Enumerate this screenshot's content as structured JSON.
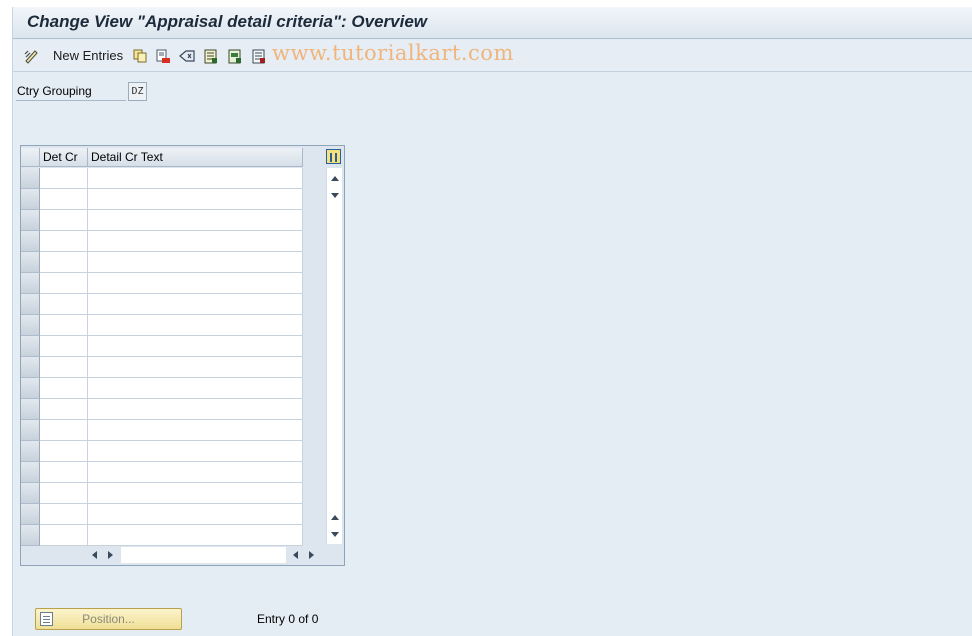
{
  "window": {
    "title": "Change View \"Appraisal detail criteria\": Overview"
  },
  "toolbar": {
    "new_entries_label": "New Entries",
    "watermark": "www.tutorialkart.com",
    "icons": [
      "edit-pencil-icon",
      "copy-icon",
      "delete-icon",
      "undo-icon",
      "select-all-icon",
      "select-block-icon",
      "deselect-all-icon"
    ]
  },
  "header_field": {
    "label": "Ctry Grouping",
    "value": "DZ"
  },
  "table": {
    "columns": [
      "Det Cr",
      "Detail Cr Text"
    ],
    "row_count": 18,
    "rows": []
  },
  "footer": {
    "position_button_label": "Position...",
    "entry_text": "Entry 0 of 0"
  },
  "colors": {
    "background": "#e4ecf4",
    "title_text": "#1c2a3a",
    "watermark": "#f0b070",
    "button_fill": "#efdf94"
  }
}
